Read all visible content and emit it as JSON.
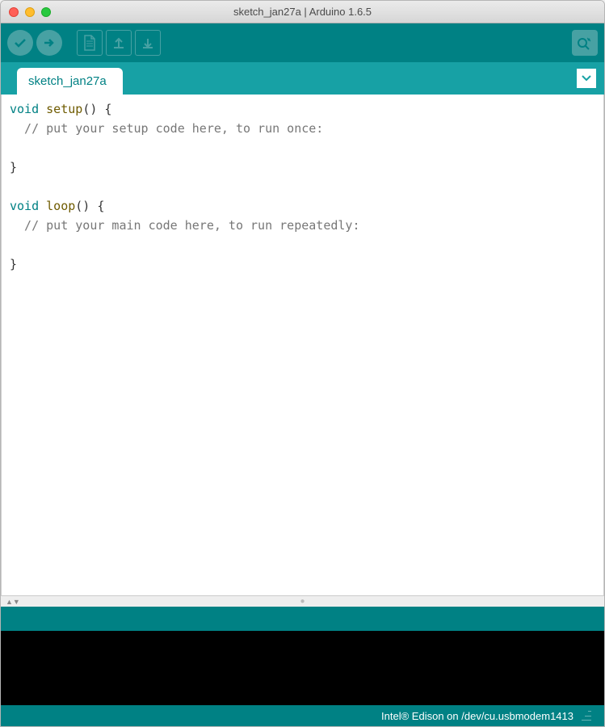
{
  "window": {
    "title": "sketch_jan27a | Arduino 1.6.5"
  },
  "toolbar": {
    "verify": "verify",
    "upload": "upload",
    "new": "new",
    "open": "open",
    "save": "save",
    "serial_monitor": "serial-monitor"
  },
  "tabs": {
    "active": "sketch_jan27a"
  },
  "editor": {
    "code": {
      "line1_kw": "void",
      "line1_fn": "setup",
      "line1_rest": "() {",
      "line2": "  // put your setup code here, to run once:",
      "line3": "",
      "line4": "}",
      "line5": "",
      "line6_kw": "void",
      "line6_fn": "loop",
      "line6_rest": "() {",
      "line7": "  // put your main code here, to run repeatedly:",
      "line8": "",
      "line9": "}"
    }
  },
  "footer": {
    "board_info": "Intel® Edison on /dev/cu.usbmodem1413"
  },
  "colors": {
    "primary": "#008184",
    "secondary": "#17a1a5",
    "accent": "#47a1a3"
  }
}
